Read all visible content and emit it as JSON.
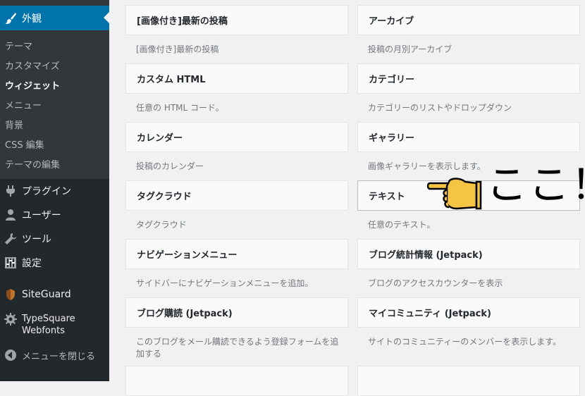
{
  "sidebar": {
    "appearance_label": "外観",
    "submenu": [
      "テーマ",
      "カスタマイズ",
      "ウィジェット",
      "メニュー",
      "背景",
      "CSS 編集",
      "テーマの編集"
    ],
    "current_submenu": "ウィジェット",
    "items": [
      {
        "label": "プラグイン",
        "icon": "plugin-icon"
      },
      {
        "label": "ユーザー",
        "icon": "user-icon"
      },
      {
        "label": "ツール",
        "icon": "wrench-icon"
      },
      {
        "label": "設定",
        "icon": "settings-sliders-icon"
      },
      {
        "label": "SiteGuard",
        "icon": "siteguard-shield-icon"
      },
      {
        "label": "TypeSquare Webfonts",
        "icon": "gear-icon"
      },
      {
        "label": "メニューを閉じる",
        "icon": "collapse-arrow-icon"
      }
    ],
    "colors": {
      "background": "#23282d",
      "active": "#0073aa",
      "submenu": "#32373c"
    }
  },
  "widgets": {
    "left": [
      {
        "title": "[画像付き]最新の投稿",
        "desc": "[画像付き]最新の投稿"
      },
      {
        "title": "カスタム HTML",
        "desc": "任意の HTML コード。"
      },
      {
        "title": "カレンダー",
        "desc": "投稿のカレンダー"
      },
      {
        "title": "タグクラウド",
        "desc": "タグクラウド"
      },
      {
        "title": "ナビゲーションメニュー",
        "desc": "サイドバーにナビゲーションメニューを追加。"
      },
      {
        "title": "ブログ購読 (Jetpack)",
        "desc": "このブログをメール購読できるよう登録フォームを追加する"
      }
    ],
    "right": [
      {
        "title": "アーカイブ",
        "desc": "投稿の月別アーカイブ"
      },
      {
        "title": "カテゴリー",
        "desc": "カテゴリーのリストやドロップダウン"
      },
      {
        "title": "ギャラリー",
        "desc": "画像ギャラリーを表示します。"
      },
      {
        "title": "テキスト",
        "desc": "任意のテキスト。"
      },
      {
        "title": "ブログ統計情報 (Jetpack)",
        "desc": "ブログのアクセスカウンターを表示"
      },
      {
        "title": "マイコミュニティ (Jetpack)",
        "desc": "サイトのコミュニティーのメンバーを表示します。"
      }
    ]
  },
  "annotation": {
    "text": "ここ！",
    "icon": "pointing-hand-icon"
  }
}
